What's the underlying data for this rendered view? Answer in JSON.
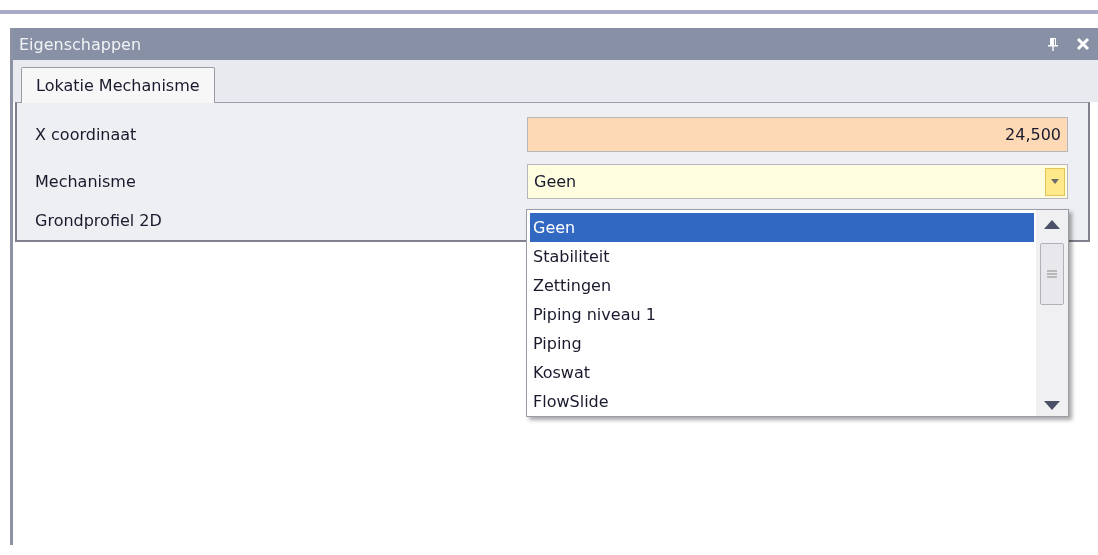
{
  "panel": {
    "title": "Eigenschappen"
  },
  "tabs": [
    {
      "label": "Lokatie Mechanisme",
      "selected": true
    }
  ],
  "properties": [
    {
      "label": "X coordinaat",
      "kind": "number",
      "value": "24,500"
    },
    {
      "label": "Mechanisme",
      "kind": "combo",
      "value": "Geen"
    },
    {
      "label": "Grondprofiel 2D",
      "kind": "empty"
    }
  ],
  "dropdown": {
    "options": [
      {
        "label": "Geen",
        "selected": true
      },
      {
        "label": "Stabiliteit",
        "selected": false
      },
      {
        "label": "Zettingen",
        "selected": false
      },
      {
        "label": "Piping niveau 1",
        "selected": false
      },
      {
        "label": "Piping",
        "selected": false
      },
      {
        "label": "Koswat",
        "selected": false
      },
      {
        "label": "FlowSlide",
        "selected": false
      }
    ]
  }
}
